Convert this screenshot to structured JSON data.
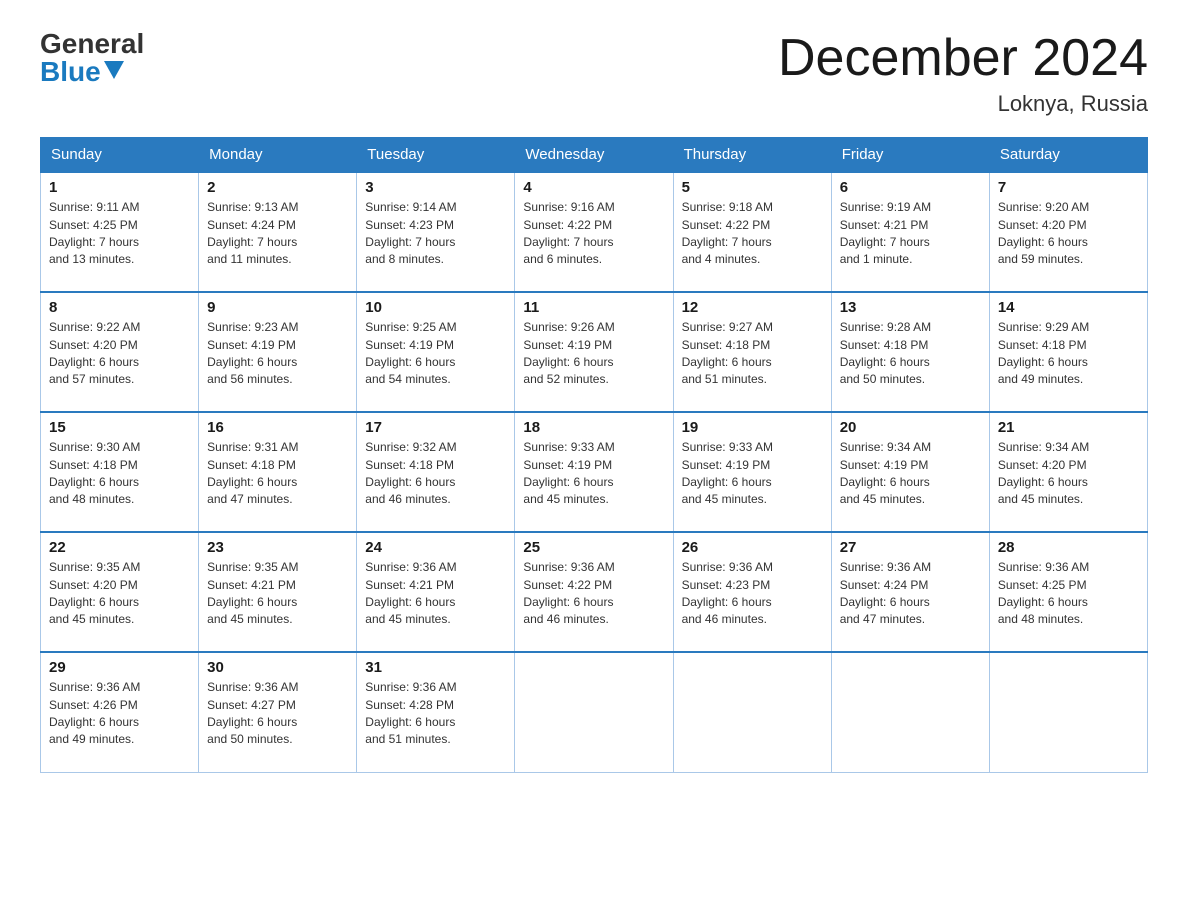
{
  "header": {
    "logo_general": "General",
    "logo_blue": "Blue",
    "month_title": "December 2024",
    "location": "Loknya, Russia"
  },
  "weekdays": [
    "Sunday",
    "Monday",
    "Tuesday",
    "Wednesday",
    "Thursday",
    "Friday",
    "Saturday"
  ],
  "weeks": [
    [
      {
        "day": "1",
        "sunrise": "9:11 AM",
        "sunset": "4:25 PM",
        "daylight": "7 hours and 13 minutes."
      },
      {
        "day": "2",
        "sunrise": "9:13 AM",
        "sunset": "4:24 PM",
        "daylight": "7 hours and 11 minutes."
      },
      {
        "day": "3",
        "sunrise": "9:14 AM",
        "sunset": "4:23 PM",
        "daylight": "7 hours and 8 minutes."
      },
      {
        "day": "4",
        "sunrise": "9:16 AM",
        "sunset": "4:22 PM",
        "daylight": "7 hours and 6 minutes."
      },
      {
        "day": "5",
        "sunrise": "9:18 AM",
        "sunset": "4:22 PM",
        "daylight": "7 hours and 4 minutes."
      },
      {
        "day": "6",
        "sunrise": "9:19 AM",
        "sunset": "4:21 PM",
        "daylight": "7 hours and 1 minute."
      },
      {
        "day": "7",
        "sunrise": "9:20 AM",
        "sunset": "4:20 PM",
        "daylight": "6 hours and 59 minutes."
      }
    ],
    [
      {
        "day": "8",
        "sunrise": "9:22 AM",
        "sunset": "4:20 PM",
        "daylight": "6 hours and 57 minutes."
      },
      {
        "day": "9",
        "sunrise": "9:23 AM",
        "sunset": "4:19 PM",
        "daylight": "6 hours and 56 minutes."
      },
      {
        "day": "10",
        "sunrise": "9:25 AM",
        "sunset": "4:19 PM",
        "daylight": "6 hours and 54 minutes."
      },
      {
        "day": "11",
        "sunrise": "9:26 AM",
        "sunset": "4:19 PM",
        "daylight": "6 hours and 52 minutes."
      },
      {
        "day": "12",
        "sunrise": "9:27 AM",
        "sunset": "4:18 PM",
        "daylight": "6 hours and 51 minutes."
      },
      {
        "day": "13",
        "sunrise": "9:28 AM",
        "sunset": "4:18 PM",
        "daylight": "6 hours and 50 minutes."
      },
      {
        "day": "14",
        "sunrise": "9:29 AM",
        "sunset": "4:18 PM",
        "daylight": "6 hours and 49 minutes."
      }
    ],
    [
      {
        "day": "15",
        "sunrise": "9:30 AM",
        "sunset": "4:18 PM",
        "daylight": "6 hours and 48 minutes."
      },
      {
        "day": "16",
        "sunrise": "9:31 AM",
        "sunset": "4:18 PM",
        "daylight": "6 hours and 47 minutes."
      },
      {
        "day": "17",
        "sunrise": "9:32 AM",
        "sunset": "4:18 PM",
        "daylight": "6 hours and 46 minutes."
      },
      {
        "day": "18",
        "sunrise": "9:33 AM",
        "sunset": "4:19 PM",
        "daylight": "6 hours and 45 minutes."
      },
      {
        "day": "19",
        "sunrise": "9:33 AM",
        "sunset": "4:19 PM",
        "daylight": "6 hours and 45 minutes."
      },
      {
        "day": "20",
        "sunrise": "9:34 AM",
        "sunset": "4:19 PM",
        "daylight": "6 hours and 45 minutes."
      },
      {
        "day": "21",
        "sunrise": "9:34 AM",
        "sunset": "4:20 PM",
        "daylight": "6 hours and 45 minutes."
      }
    ],
    [
      {
        "day": "22",
        "sunrise": "9:35 AM",
        "sunset": "4:20 PM",
        "daylight": "6 hours and 45 minutes."
      },
      {
        "day": "23",
        "sunrise": "9:35 AM",
        "sunset": "4:21 PM",
        "daylight": "6 hours and 45 minutes."
      },
      {
        "day": "24",
        "sunrise": "9:36 AM",
        "sunset": "4:21 PM",
        "daylight": "6 hours and 45 minutes."
      },
      {
        "day": "25",
        "sunrise": "9:36 AM",
        "sunset": "4:22 PM",
        "daylight": "6 hours and 46 minutes."
      },
      {
        "day": "26",
        "sunrise": "9:36 AM",
        "sunset": "4:23 PM",
        "daylight": "6 hours and 46 minutes."
      },
      {
        "day": "27",
        "sunrise": "9:36 AM",
        "sunset": "4:24 PM",
        "daylight": "6 hours and 47 minutes."
      },
      {
        "day": "28",
        "sunrise": "9:36 AM",
        "sunset": "4:25 PM",
        "daylight": "6 hours and 48 minutes."
      }
    ],
    [
      {
        "day": "29",
        "sunrise": "9:36 AM",
        "sunset": "4:26 PM",
        "daylight": "6 hours and 49 minutes."
      },
      {
        "day": "30",
        "sunrise": "9:36 AM",
        "sunset": "4:27 PM",
        "daylight": "6 hours and 50 minutes."
      },
      {
        "day": "31",
        "sunrise": "9:36 AM",
        "sunset": "4:28 PM",
        "daylight": "6 hours and 51 minutes."
      },
      null,
      null,
      null,
      null
    ]
  ],
  "labels": {
    "sunrise": "Sunrise:",
    "sunset": "Sunset:",
    "daylight": "Daylight:"
  }
}
